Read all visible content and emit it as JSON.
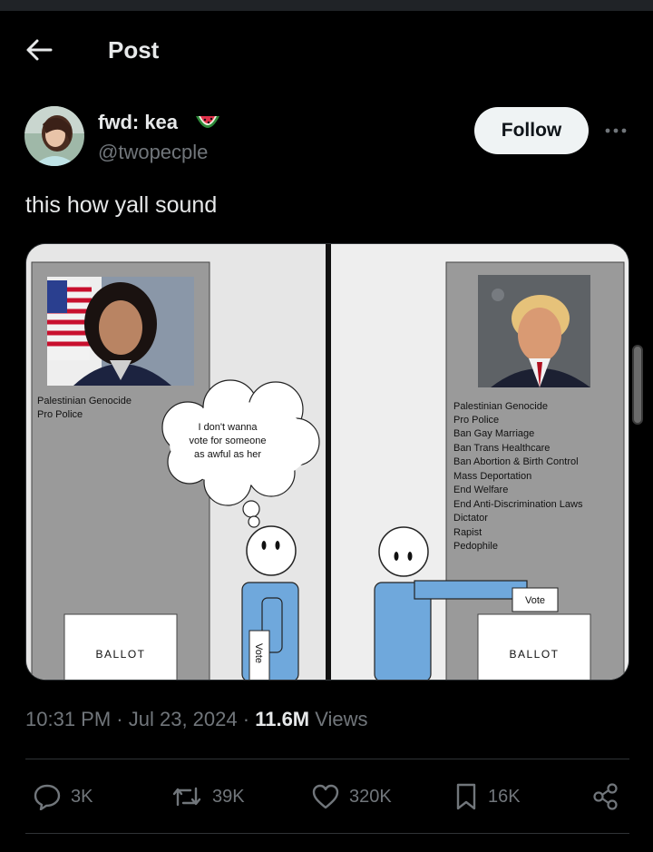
{
  "header": {
    "title": "Post",
    "back_icon": "arrow-left-icon"
  },
  "author": {
    "display_name": "fwd: kea",
    "name_emoji": "watermelon-icon",
    "handle": "@twopecple"
  },
  "actions_top": {
    "follow_label": "Follow",
    "more_icon": "more-dots-icon"
  },
  "tweet": {
    "text": "this how yall sound"
  },
  "comic": {
    "left_panel": {
      "policies": [
        "Palestinian Genocide",
        "Pro Police"
      ],
      "thought_bubble": [
        "I don't wanna",
        "vote for someone",
        "as awful as her"
      ],
      "ballot_label": "BALLOT",
      "vote_label": "Vote"
    },
    "right_panel": {
      "policies": [
        "Palestinian Genocide",
        "Pro Police",
        "Ban Gay Marriage",
        "Ban Trans Healthcare",
        "Ban Abortion & Birth Control",
        "Mass Deportation",
        "End Welfare",
        "End Anti-Discrimination Laws",
        "Dictator",
        "Rapist",
        "Pedophile"
      ],
      "ballot_label": "BALLOT",
      "vote_label": "Vote"
    }
  },
  "meta": {
    "time": "10:31 PM",
    "separator": "·",
    "date": "Jul 23, 2024",
    "views_count": "11.6M",
    "views_label": "Views"
  },
  "engagement": {
    "replies": "3K",
    "reposts": "39K",
    "likes": "320K",
    "bookmarks": "16K"
  },
  "colors": {
    "background": "#000000",
    "text": "#e7e9ea",
    "muted": "#71767b",
    "follow_bg": "#eff3f4",
    "comic_blue": "#6fa8dc"
  }
}
